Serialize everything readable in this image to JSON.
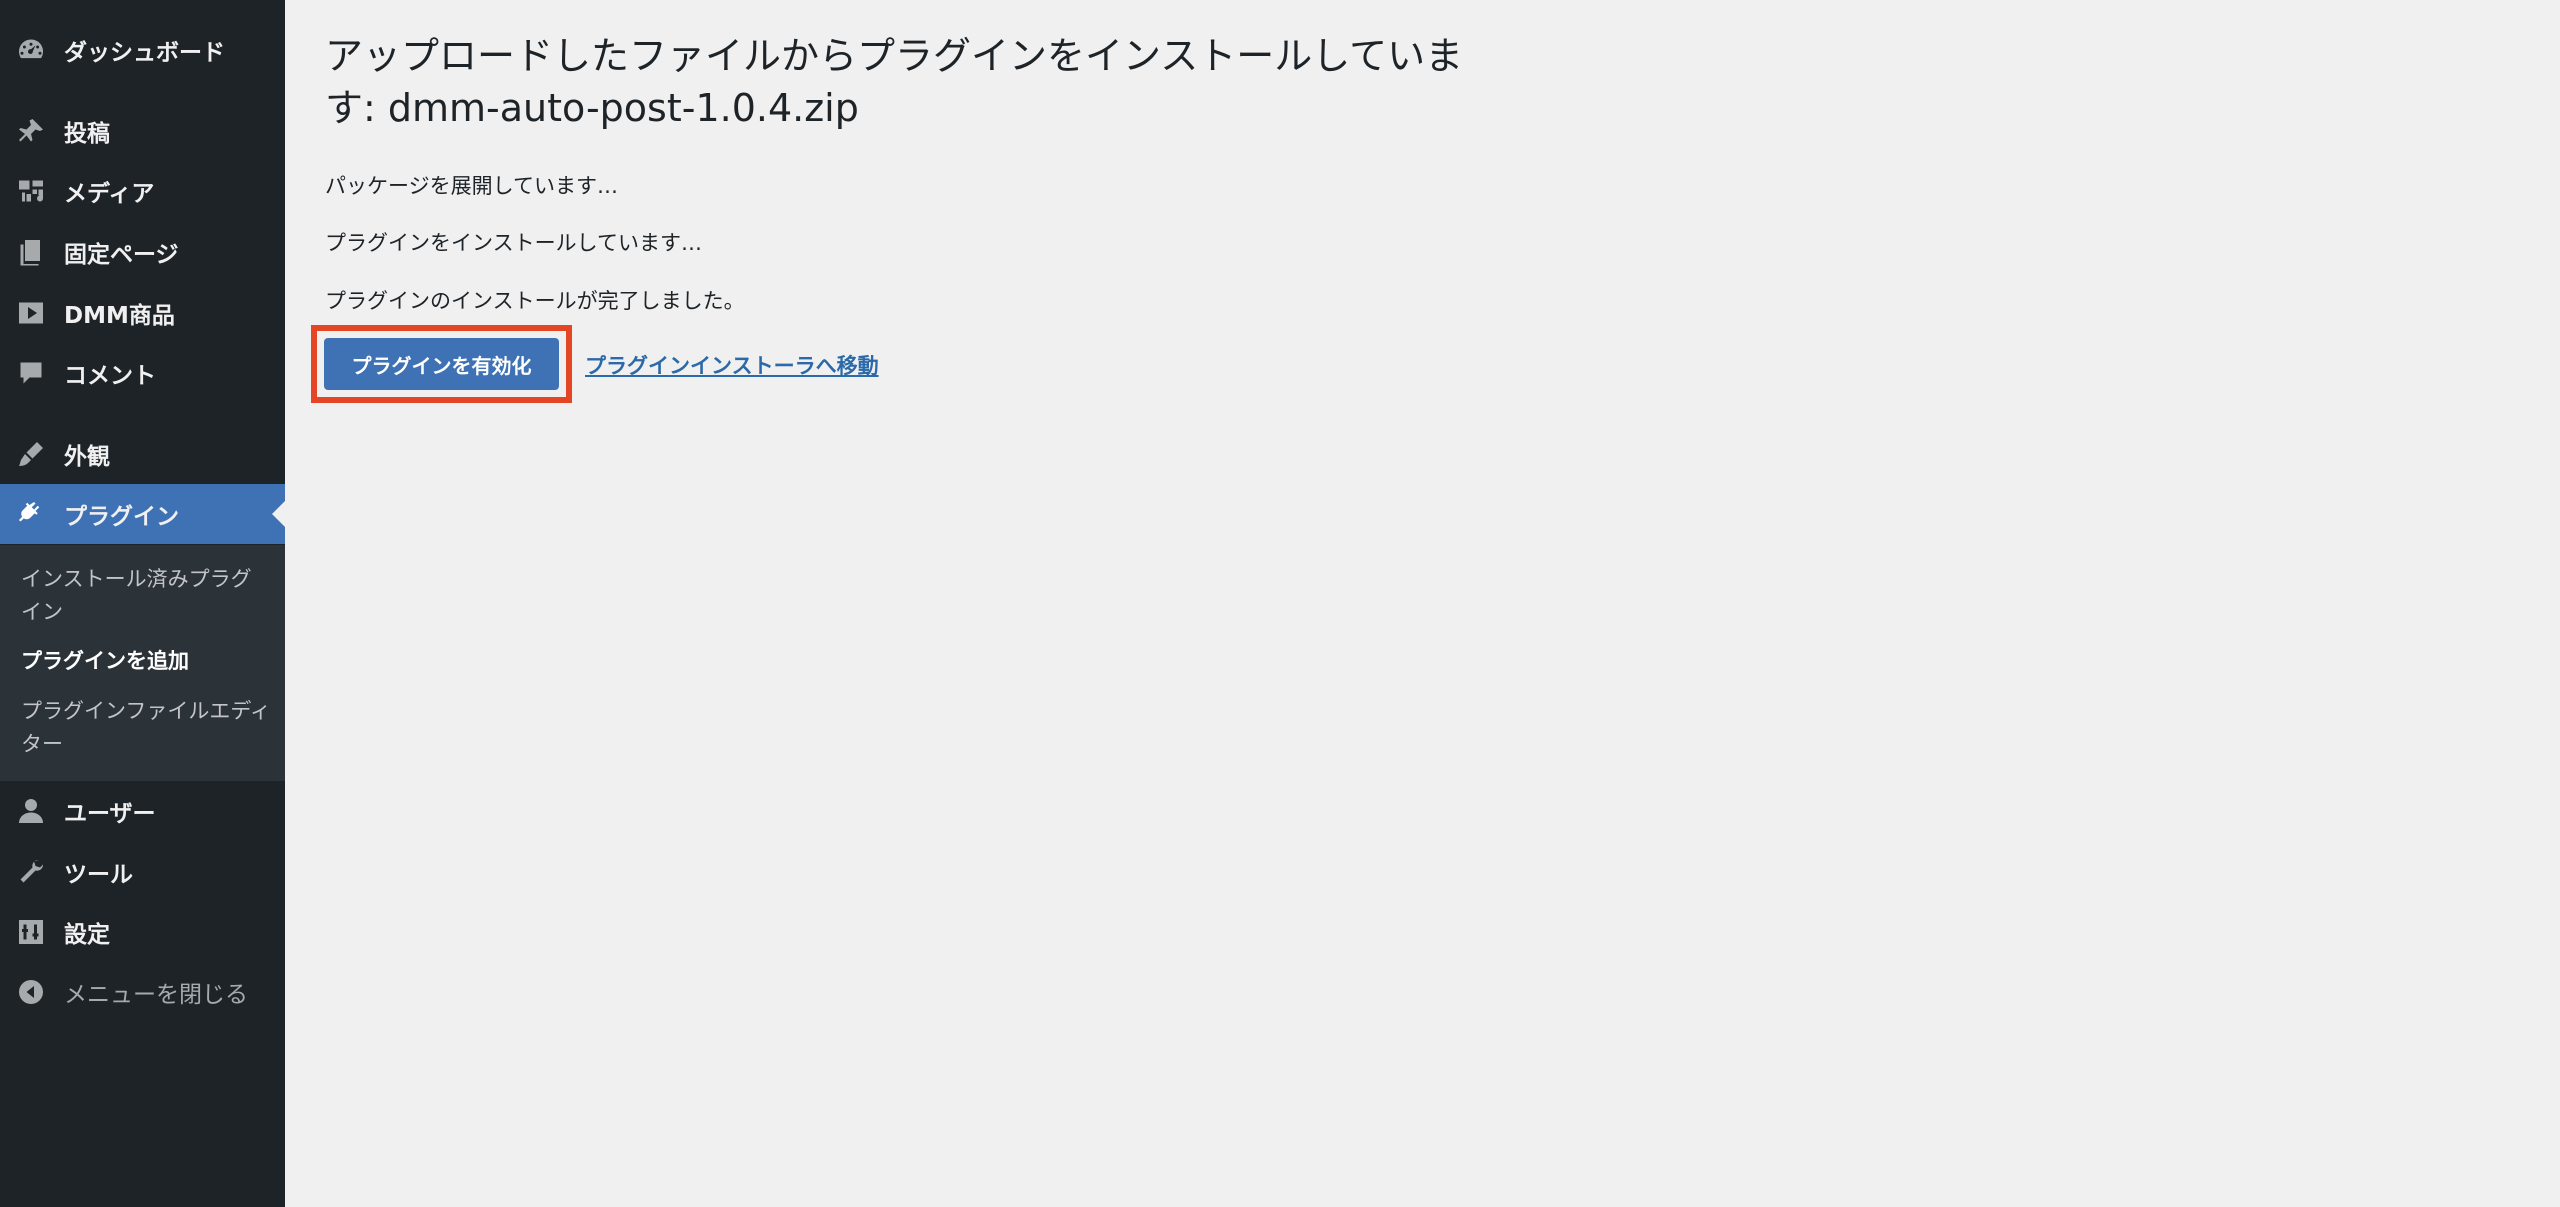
{
  "sidebar": {
    "items": [
      {
        "label": "ダッシュボード",
        "icon": "dashboard-icon"
      },
      {
        "label": "投稿",
        "icon": "pin-icon"
      },
      {
        "label": "メディア",
        "icon": "media-icon"
      },
      {
        "label": "固定ページ",
        "icon": "pages-icon"
      },
      {
        "label": "DMM商品",
        "icon": "play-icon"
      },
      {
        "label": "コメント",
        "icon": "comment-icon"
      },
      {
        "label": "外観",
        "icon": "brush-icon"
      },
      {
        "label": "プラグイン",
        "icon": "plugin-icon"
      },
      {
        "label": "ユーザー",
        "icon": "user-icon"
      },
      {
        "label": "ツール",
        "icon": "wrench-icon"
      },
      {
        "label": "設定",
        "icon": "settings-icon"
      },
      {
        "label": "メニューを閉じる",
        "icon": "collapse-icon"
      }
    ],
    "submenu": [
      {
        "label": "インストール済みプラグイン"
      },
      {
        "label": "プラグインを追加"
      },
      {
        "label": "プラグインファイルエディター"
      }
    ]
  },
  "main": {
    "title": "アップロードしたファイルからプラグインをインストールしています: dmm-auto-post-1.0.4.zip",
    "messages": [
      "パッケージを展開しています…",
      "プラグインをインストールしています…",
      "プラグインのインストールが完了しました。"
    ],
    "activate_button": "プラグインを有効化",
    "installer_link": "プラグインインストーラへ移動"
  },
  "colors": {
    "sidebar_bg": "#1d2327",
    "submenu_bg": "#2c3338",
    "accent": "#3f72b5",
    "highlight": "#e34525",
    "link": "#2c69a8",
    "page_bg": "#f0f0f1"
  }
}
